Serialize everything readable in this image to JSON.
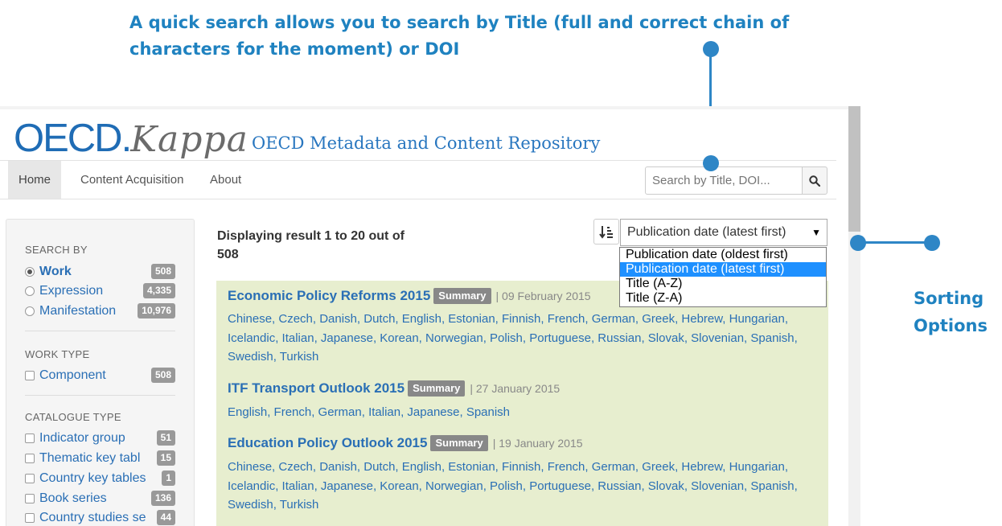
{
  "annotations": {
    "quick_search": "A quick search allows you to search by Title  (full and correct chain of characters for the moment) or DOI",
    "sorting_line1": "Sorting",
    "sorting_line2": "Options"
  },
  "header": {
    "logo_oecd": "OECD.",
    "logo_kappa": "Kappa",
    "repo_title": "OECD Metadata and Content Repository"
  },
  "nav": {
    "items": [
      {
        "label": "Home",
        "active": true
      },
      {
        "label": "Content Acquisition"
      },
      {
        "label": "About"
      }
    ],
    "search_placeholder": "Search by Title, DOI...",
    "search_icon": "magnifier-icon"
  },
  "sidebar": {
    "search_by": {
      "heading": "SEARCH BY",
      "options": [
        {
          "label": "Work",
          "count": "508",
          "selected": true
        },
        {
          "label": "Expression",
          "count": "4,335"
        },
        {
          "label": "Manifestation",
          "count": "10,976"
        }
      ]
    },
    "work_type": {
      "heading": "WORK TYPE",
      "options": [
        {
          "label": "Component",
          "count": "508"
        }
      ]
    },
    "catalogue_type": {
      "heading": "CATALOGUE TYPE",
      "options": [
        {
          "label": "Indicator group",
          "count": "51"
        },
        {
          "label": "Thematic key tabl",
          "count": "15"
        },
        {
          "label": "Country key tables",
          "count": "1"
        },
        {
          "label": "Book series",
          "count": "136"
        },
        {
          "label": "Country studies se",
          "count": "44"
        }
      ]
    }
  },
  "results": {
    "count_text": "Displaying result 1 to 20 out of 508",
    "sort": {
      "selected": "Publication date (latest first)",
      "options": [
        "Publication date (oldest first)",
        "Publication date (latest first)",
        "Title (A-Z)",
        "Title (Z-A)"
      ],
      "highlighted_index": 1
    },
    "items": [
      {
        "title": "Economic Policy Reforms 2015",
        "badge": "Summary",
        "date": "| 09 February 2015",
        "languages": "Chinese, Czech, Danish, Dutch, English, Estonian, Finnish, French, German, Greek, Hebrew, Hungarian, Icelandic, Italian, Japanese, Korean, Norwegian, Polish, Portuguese, Russian, Slovak, Slovenian, Spanish, Swedish, Turkish"
      },
      {
        "title": "ITF Transport Outlook 2015",
        "badge": "Summary",
        "date": "| 27 January 2015",
        "languages": "English, French, German, Italian, Japanese, Spanish"
      },
      {
        "title": "Education Policy Outlook 2015",
        "badge": "Summary",
        "date": "| 19 January 2015",
        "languages": "Chinese, Czech, Danish, Dutch, English, Estonian, Finnish, French, German, Greek, Hebrew, Hungarian, Icelandic, Italian, Japanese, Korean, Norwegian, Polish, Portuguese, Russian, Slovak, Slovenian, Spanish, Swedish, Turkish"
      }
    ]
  },
  "colors": {
    "annotation_blue": "#1f82c0",
    "link_blue": "#2a6fb5",
    "result_bg": "#e7eecf",
    "dropdown_highlight": "#1e90ff"
  }
}
